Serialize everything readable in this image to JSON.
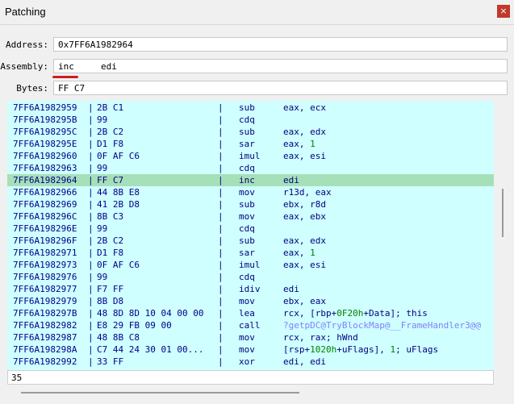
{
  "window": {
    "title": "Patching",
    "close_label": "×"
  },
  "fields": {
    "address": {
      "label": "Address:",
      "value": "0x7FF6A1982964"
    },
    "assembly": {
      "label": "Assembly:",
      "value": "inc     edi"
    },
    "bytes": {
      "label": "Bytes:",
      "value": "FF C7"
    }
  },
  "separator": "|",
  "rows": [
    {
      "addr": "7FF6A1982959",
      "bytes": "2B C1",
      "mn": "sub",
      "op": [
        {
          "t": "eax, ecx"
        }
      ]
    },
    {
      "addr": "7FF6A198295B",
      "bytes": "99",
      "mn": "cdq",
      "op": []
    },
    {
      "addr": "7FF6A198295C",
      "bytes": "2B C2",
      "mn": "sub",
      "op": [
        {
          "t": "eax, edx"
        }
      ]
    },
    {
      "addr": "7FF6A198295E",
      "bytes": "D1 F8",
      "mn": "sar",
      "op": [
        {
          "t": "eax, "
        },
        {
          "t": "1",
          "c": "num"
        }
      ]
    },
    {
      "addr": "7FF6A1982960",
      "bytes": "0F AF C6",
      "mn": "imul",
      "op": [
        {
          "t": "eax, esi"
        }
      ]
    },
    {
      "addr": "7FF6A1982963",
      "bytes": "99",
      "mn": "cdq",
      "op": []
    },
    {
      "addr": "7FF6A1982964",
      "bytes": "FF C7",
      "mn": "inc",
      "op": [
        {
          "t": "edi"
        }
      ],
      "selected": true
    },
    {
      "addr": "7FF6A1982966",
      "bytes": "44 8B E8",
      "mn": "mov",
      "op": [
        {
          "t": "r13d, eax"
        }
      ]
    },
    {
      "addr": "7FF6A1982969",
      "bytes": "41 2B D8",
      "mn": "sub",
      "op": [
        {
          "t": "ebx, r8d"
        }
      ]
    },
    {
      "addr": "7FF6A198296C",
      "bytes": "8B C3",
      "mn": "mov",
      "op": [
        {
          "t": "eax, ebx"
        }
      ]
    },
    {
      "addr": "7FF6A198296E",
      "bytes": "99",
      "mn": "cdq",
      "op": []
    },
    {
      "addr": "7FF6A198296F",
      "bytes": "2B C2",
      "mn": "sub",
      "op": [
        {
          "t": "eax, edx"
        }
      ]
    },
    {
      "addr": "7FF6A1982971",
      "bytes": "D1 F8",
      "mn": "sar",
      "op": [
        {
          "t": "eax, "
        },
        {
          "t": "1",
          "c": "num"
        }
      ]
    },
    {
      "addr": "7FF6A1982973",
      "bytes": "0F AF C6",
      "mn": "imul",
      "op": [
        {
          "t": "eax, esi"
        }
      ]
    },
    {
      "addr": "7FF6A1982976",
      "bytes": "99",
      "mn": "cdq",
      "op": []
    },
    {
      "addr": "7FF6A1982977",
      "bytes": "F7 FF",
      "mn": "idiv",
      "op": [
        {
          "t": "edi"
        }
      ]
    },
    {
      "addr": "7FF6A1982979",
      "bytes": "8B D8",
      "mn": "mov",
      "op": [
        {
          "t": "ebx, eax"
        }
      ]
    },
    {
      "addr": "7FF6A198297B",
      "bytes": "48 8D 8D 10 04 00 00",
      "mn": "lea",
      "op": [
        {
          "t": "rcx, [rbp+"
        },
        {
          "t": "0F20h",
          "c": "num"
        },
        {
          "t": "+Data]; this"
        }
      ]
    },
    {
      "addr": "7FF6A1982982",
      "bytes": "E8 29 FB 09 00",
      "mn": "call",
      "op": [
        {
          "t": "?getpDC@TryBlockMap@__FrameHandler3@@",
          "c": "sym"
        }
      ]
    },
    {
      "addr": "7FF6A1982987",
      "bytes": "48 8B C8",
      "mn": "mov",
      "op": [
        {
          "t": "rcx, rax; hWnd"
        }
      ]
    },
    {
      "addr": "7FF6A198298A",
      "bytes": "C7 44 24 30 01 00...",
      "mn": "mov",
      "op": [
        {
          "t": "[rsp+"
        },
        {
          "t": "1020h",
          "c": "num"
        },
        {
          "t": "+uFlags], "
        },
        {
          "t": "1",
          "c": "num"
        },
        {
          "t": "; uFlags"
        }
      ]
    },
    {
      "addr": "7FF6A1982992",
      "bytes": "33 FF",
      "mn": "xor",
      "op": [
        {
          "t": "edi, edi"
        }
      ]
    }
  ],
  "footer": {
    "count": "35"
  }
}
